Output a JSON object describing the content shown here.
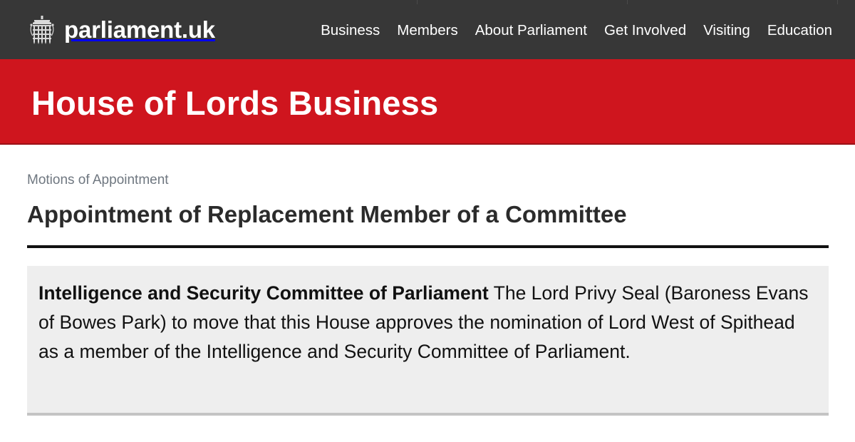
{
  "header": {
    "site_name": "parliament.uk",
    "logo_icon": "portcullis-icon",
    "nav": [
      {
        "label": "Business"
      },
      {
        "label": "Members"
      },
      {
        "label": "About Parliament"
      },
      {
        "label": "Get Involved"
      },
      {
        "label": "Visiting"
      },
      {
        "label": "Education"
      }
    ]
  },
  "banner": {
    "title": "House of Lords Business",
    "color": "#cf151e"
  },
  "content": {
    "breadcrumb": "Motions of Appointment",
    "title": "Appointment of Replacement Member of a Committee",
    "motion": {
      "committee": "Intelligence and Security Committee of Parliament",
      "text": "The Lord Privy Seal (Baroness Evans of Bowes Park) to move that this House approves the nomination of Lord West of Spithead as a member of the Intelligence and Security Committee of Parliament."
    }
  },
  "colors": {
    "topbar": "#373737",
    "banner": "#cf151e",
    "box": "#eeeeee"
  }
}
